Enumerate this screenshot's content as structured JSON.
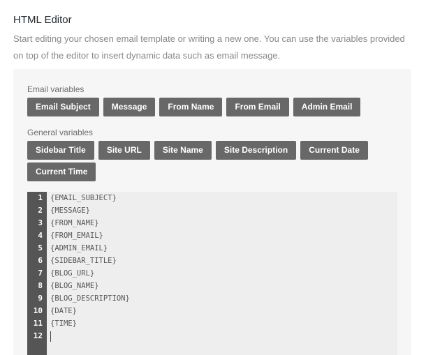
{
  "header": {
    "title": "HTML Editor",
    "description": "Start editing your chosen email template or writing a new one. You can use the variables provided on top of the editor to insert dynamic data such as email message."
  },
  "email_variables": {
    "label": "Email variables",
    "buttons": [
      "Email Subject",
      "Message",
      "From Name",
      "From Email",
      "Admin Email"
    ]
  },
  "general_variables": {
    "label": "General variables",
    "buttons": [
      "Sidebar Title",
      "Site URL",
      "Site Name",
      "Site Description",
      "Current Date",
      "Current Time"
    ]
  },
  "editor": {
    "line_numbers": [
      "1",
      "2",
      "3",
      "4",
      "5",
      "6",
      "7",
      "8",
      "9",
      "10",
      "11",
      "12"
    ],
    "lines": [
      "{EMAIL_SUBJECT}",
      "{MESSAGE}",
      "{FROM_NAME}",
      "{FROM_EMAIL}",
      "{ADMIN_EMAIL}",
      "{SIDEBAR_TITLE}",
      "{BLOG_URL}",
      "{BLOG_NAME}",
      "{BLOG_DESCRIPTION}",
      "{DATE}",
      "{TIME}",
      ""
    ]
  },
  "colors": {
    "button_bg": "#686868",
    "panel_bg": "#f6f6f6",
    "editor_bg": "#eeeeee",
    "gutter_bg": "#555555"
  }
}
